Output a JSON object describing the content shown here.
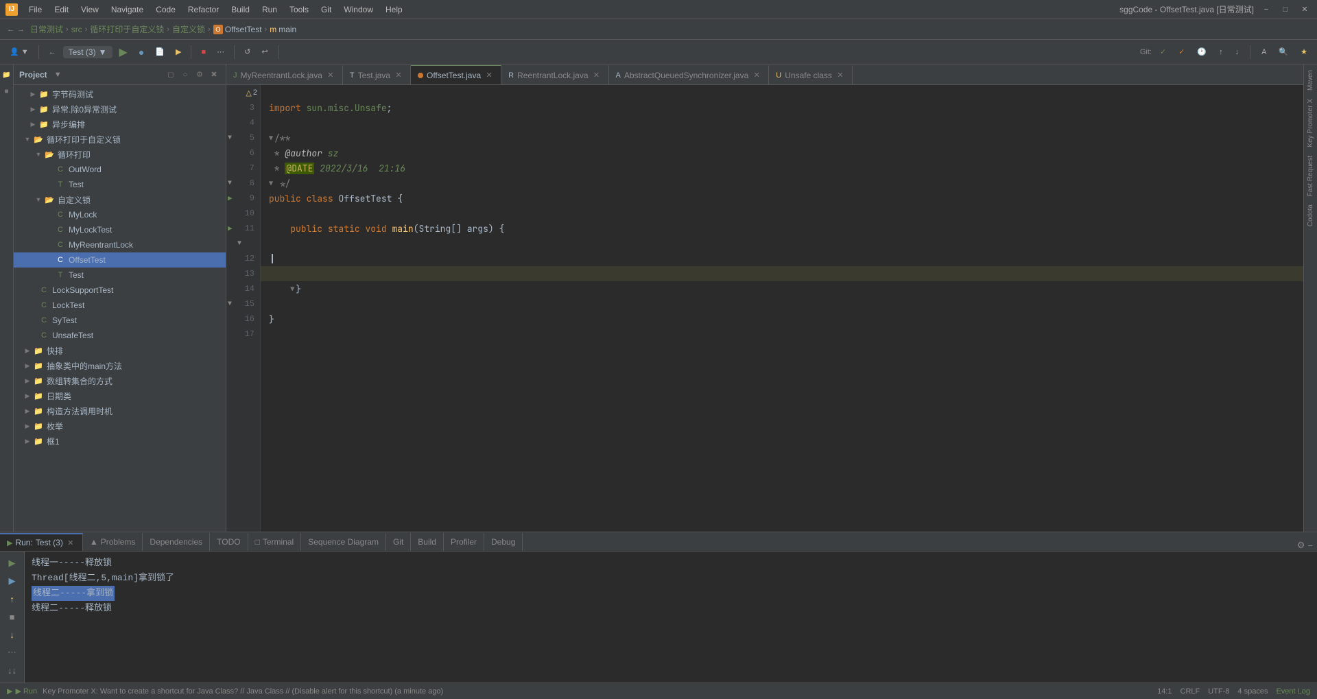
{
  "app": {
    "title": "sggCode - OffsetTest.java [日常测试]",
    "icon_label": "IJ"
  },
  "menu": {
    "items": [
      "File",
      "Edit",
      "View",
      "Navigate",
      "Code",
      "Refactor",
      "Build",
      "Run",
      "Tools",
      "Git",
      "Window",
      "Help"
    ]
  },
  "breadcrumb": {
    "items": [
      "日常测试",
      "src",
      "循环打印于自定义锁",
      "自定义锁"
    ],
    "current": "OffsetTest",
    "method": "main"
  },
  "run_config": {
    "label": "Test (3)",
    "arrow": "▶"
  },
  "tabs": [
    {
      "name": "MyReentrantLock.java",
      "icon": "J",
      "color": "#6a8759",
      "active": false
    },
    {
      "name": "Test.java",
      "icon": "T",
      "color": "#a9b7c6",
      "active": false
    },
    {
      "name": "OffsetTest.java",
      "icon": "O",
      "color": "#cc7832",
      "active": true
    },
    {
      "name": "ReentrantLock.java",
      "icon": "R",
      "color": "#a9b7c6",
      "active": false
    },
    {
      "name": "AbstractQueuedSynchronizer.java",
      "icon": "A",
      "color": "#a9b7c6",
      "active": false
    },
    {
      "name": "Unsafe.class",
      "icon": "U",
      "color": "#e8c46a",
      "active": false
    }
  ],
  "code_lines": [
    {
      "num": "3",
      "content": "import sun.misc.Unsafe;",
      "type": "import"
    },
    {
      "num": "4",
      "content": "",
      "type": "empty"
    },
    {
      "num": "5",
      "content": "/**",
      "type": "comment",
      "fold": true
    },
    {
      "num": "6",
      "content": " * @author sz",
      "type": "comment"
    },
    {
      "num": "7",
      "content": " * @DATE 2022/3/16  21:16",
      "type": "comment"
    },
    {
      "num": "8",
      "content": " */",
      "type": "comment",
      "fold": true
    },
    {
      "num": "9",
      "content": "public class OffsetTest {",
      "type": "class",
      "run": true
    },
    {
      "num": "10",
      "content": "",
      "type": "empty"
    },
    {
      "num": "11",
      "content": "    public static void main(String[] args) {",
      "type": "method",
      "run": true,
      "fold": true
    },
    {
      "num": "12",
      "content": "",
      "type": "empty"
    },
    {
      "num": "13",
      "content": "",
      "type": "empty"
    },
    {
      "num": "14",
      "content": "",
      "type": "current",
      "highlighted": true
    },
    {
      "num": "15",
      "content": "    }",
      "type": "close"
    },
    {
      "num": "16",
      "content": "",
      "type": "empty"
    },
    {
      "num": "17",
      "content": "}",
      "type": "close"
    }
  ],
  "project_panel": {
    "title": "Project",
    "tree_items": [
      {
        "label": "字节码测试",
        "indent": 16,
        "type": "folder",
        "arrow": "▶"
      },
      {
        "label": "异常.除0异常测试",
        "indent": 16,
        "type": "folder",
        "arrow": "▶"
      },
      {
        "label": "异步编排",
        "indent": 16,
        "type": "folder",
        "arrow": "▶"
      },
      {
        "label": "循环打印于自定义锁",
        "indent": 8,
        "type": "folder",
        "arrow": "▼",
        "open": true
      },
      {
        "label": "循环打印",
        "indent": 24,
        "type": "folder",
        "arrow": "▼",
        "open": true
      },
      {
        "label": "OutWord",
        "indent": 40,
        "type": "class",
        "icon": "C"
      },
      {
        "label": "Test",
        "indent": 40,
        "type": "class",
        "icon": "T"
      },
      {
        "label": "自定义锁",
        "indent": 24,
        "type": "folder",
        "arrow": "▼",
        "open": true
      },
      {
        "label": "MyLock",
        "indent": 40,
        "type": "class",
        "icon": "C"
      },
      {
        "label": "MyLockTest",
        "indent": 40,
        "type": "class",
        "icon": "C"
      },
      {
        "label": "MyReentrantLock",
        "indent": 40,
        "type": "class",
        "icon": "C"
      },
      {
        "label": "OffsetTest",
        "indent": 40,
        "type": "class",
        "icon": "C",
        "selected": true
      },
      {
        "label": "Test",
        "indent": 40,
        "type": "class",
        "icon": "T"
      },
      {
        "label": "LockSupportTest",
        "indent": 16,
        "type": "class",
        "icon": "C"
      },
      {
        "label": "LockTest",
        "indent": 16,
        "type": "class",
        "icon": "C"
      },
      {
        "label": "SyTest",
        "indent": 16,
        "type": "class",
        "icon": "C"
      },
      {
        "label": "UnsafeTest",
        "indent": 16,
        "type": "class",
        "icon": "C"
      },
      {
        "label": "快排",
        "indent": 8,
        "type": "folder",
        "arrow": "▶"
      },
      {
        "label": "抽象类中的main方法",
        "indent": 8,
        "type": "folder",
        "arrow": "▶"
      },
      {
        "label": "数组转集合的方式",
        "indent": 8,
        "type": "folder",
        "arrow": "▶"
      },
      {
        "label": "日期类",
        "indent": 8,
        "type": "folder",
        "arrow": "▶"
      },
      {
        "label": "构造方法调用时机",
        "indent": 8,
        "type": "folder",
        "arrow": "▶"
      },
      {
        "label": "枚举",
        "indent": 8,
        "type": "folder",
        "arrow": "▶"
      },
      {
        "label": "框1",
        "indent": 8,
        "type": "folder",
        "arrow": "▶"
      }
    ]
  },
  "run_panel": {
    "title": "Run:",
    "config": "Test (3)",
    "output": [
      {
        "text": "线程一-----释放锁",
        "selected": false
      },
      {
        "text": "Thread[线程二,5,main]拿到锁了",
        "selected": false
      },
      {
        "text": "线程二-----拿到锁",
        "selected": true
      },
      {
        "text": "线程二-----释放锁",
        "selected": false
      }
    ]
  },
  "bottom_tabs": [
    "Run",
    "Problems",
    "Dependencies",
    "TODO",
    "Terminal",
    "Sequence Diagram",
    "Git",
    "Build",
    "Profiler",
    "Debug"
  ],
  "status_bar": {
    "run_label": "▶ Run",
    "position": "14:1",
    "line_ending": "CRLF",
    "encoding": "UTF-8",
    "indent": "4 spaces",
    "warnings": "2",
    "event_log": "Event Log"
  },
  "notification": {
    "text": "Key Promoter X: Want to create a shortcut for Java Class? // Java Class // (Disable alert for this shortcut) (a minute ago)"
  },
  "right_sidebar": {
    "items": [
      "Maven",
      "Key Promoter X",
      "Fast Request",
      "Codota"
    ]
  },
  "unsafe_class_label": "Unsafe class"
}
